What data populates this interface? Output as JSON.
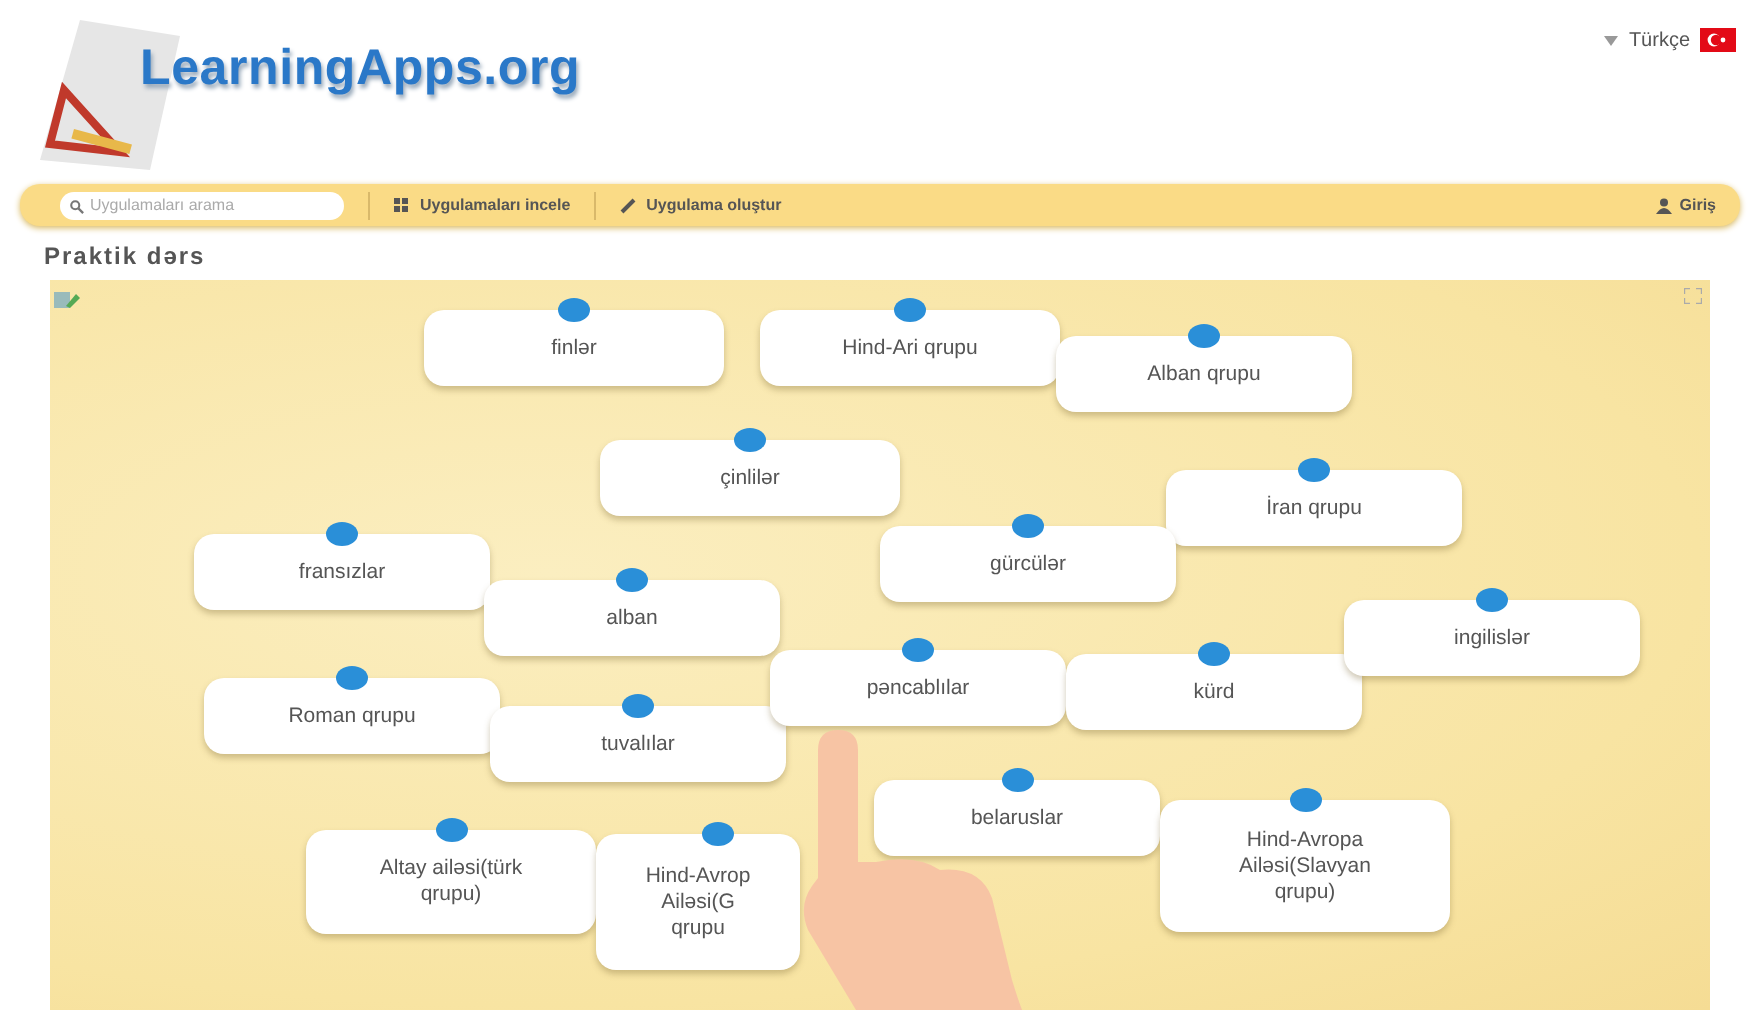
{
  "header": {
    "logo": "LearningApps.org",
    "language": "Türkçe"
  },
  "nav": {
    "search_placeholder": "Uygulamaları arama",
    "links": [
      "Uygulamaları incele",
      "Uygulama oluştur"
    ],
    "login": "Giriş"
  },
  "title": "Praktik dərs",
  "board": {
    "cards": [
      {
        "lines": [
          "finlər"
        ]
      },
      {
        "lines": [
          "Hind-Ari qrupu"
        ]
      },
      {
        "lines": [
          "Alban qrupu"
        ]
      },
      {
        "lines": [
          "çinlilər"
        ]
      },
      {
        "lines": [
          "İran qrupu"
        ]
      },
      {
        "lines": [
          "fransızlar"
        ]
      },
      {
        "lines": [
          "alban"
        ]
      },
      {
        "lines": [
          "gürcülər"
        ]
      },
      {
        "lines": [
          "Roman qrupu"
        ]
      },
      {
        "lines": [
          "tuvalılar"
        ]
      },
      {
        "lines": [
          "pəncablılar"
        ]
      },
      {
        "lines": [
          "kürd"
        ]
      },
      {
        "lines": [
          "ingilislər"
        ]
      },
      {
        "lines": [
          "Altay ailəsi(türk",
          "qrupu)"
        ]
      },
      {
        "lines": [
          "Hind-Avrop",
          "Ailəsi(G",
          "qrupu"
        ]
      },
      {
        "lines": [
          "belaruslar"
        ]
      },
      {
        "lines": [
          "Hind-Avropa",
          "Ailəsi(Slavyan",
          "qrupu)"
        ]
      }
    ]
  }
}
